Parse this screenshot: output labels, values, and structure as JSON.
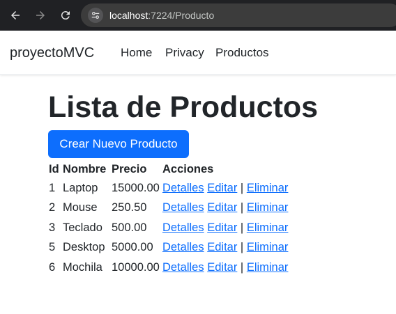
{
  "browser": {
    "url_host": "localhost",
    "url_path": ":7224/Producto",
    "chrome_bg": "#202124",
    "icons": [
      "back-arrow-icon",
      "forward-arrow-icon",
      "reload-icon",
      "site-info-icon"
    ]
  },
  "navbar": {
    "brand": "proyectoMVC",
    "links": [
      "Home",
      "Privacy",
      "Productos"
    ]
  },
  "main": {
    "title": "Lista de Productos",
    "create_label": "Crear Nuevo Producto",
    "accent": "#0d6efd",
    "table": {
      "headers": [
        "Id",
        "Nombre",
        "Precio",
        "Acciones"
      ],
      "rows": [
        {
          "id": "1",
          "nombre": "Laptop",
          "precio": "15000.00"
        },
        {
          "id": "2",
          "nombre": "Mouse",
          "precio": "250.50"
        },
        {
          "id": "3",
          "nombre": "Teclado",
          "precio": "500.00"
        },
        {
          "id": "5",
          "nombre": "Desktop",
          "precio": "5000.00"
        },
        {
          "id": "6",
          "nombre": "Mochila",
          "precio": "10000.00"
        }
      ],
      "actions": {
        "details": "Detalles",
        "edit": "Editar",
        "separator": "|",
        "delete": "Eliminar"
      }
    }
  }
}
